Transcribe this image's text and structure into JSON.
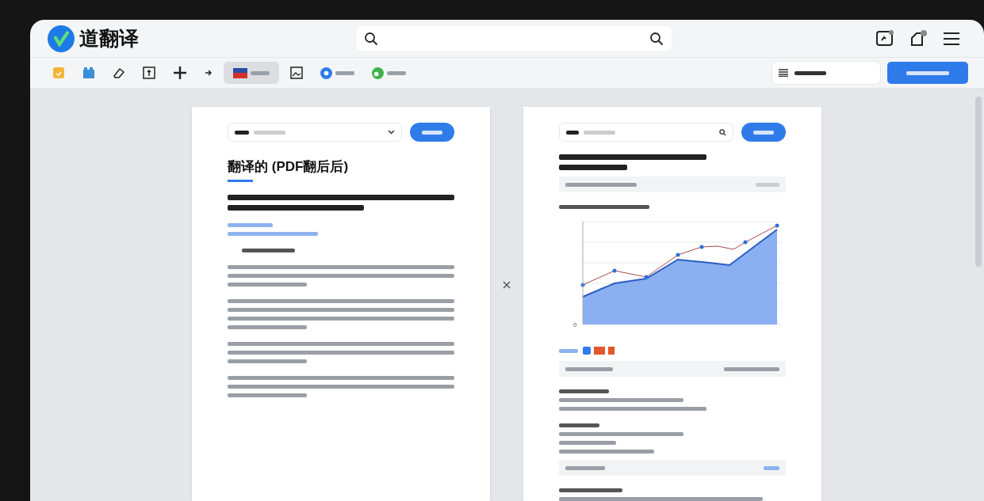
{
  "app": {
    "logo_text": "道翻译"
  },
  "toolbar": {
    "tools": [
      {
        "selected": false
      },
      {
        "selected": false
      },
      {
        "selected": false
      },
      {
        "selected": false
      },
      {
        "selected": false
      },
      {
        "selected": false
      },
      {
        "selected": true
      },
      {
        "selected": false
      },
      {
        "selected": false
      },
      {
        "selected": false
      }
    ]
  },
  "source_page": {
    "title": "翻译的 (PDF翻后后)"
  },
  "chart": {
    "y_zero_label": "0"
  }
}
